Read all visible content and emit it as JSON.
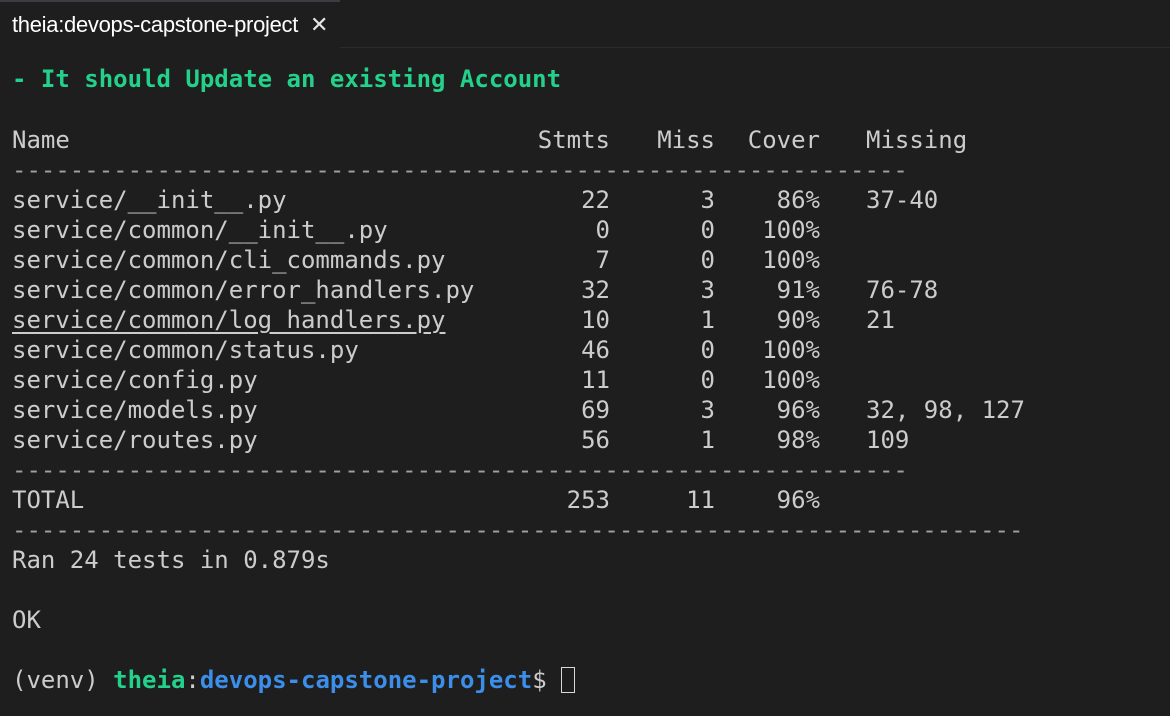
{
  "tab": {
    "title": "theia:devops-capstone-project",
    "close": "✕"
  },
  "test_line": "- It should Update an existing Account",
  "table": {
    "headers": {
      "name": "Name",
      "stmts": "Stmts",
      "miss": "Miss",
      "cover": "Cover",
      "missing": "Missing"
    },
    "rule": "--------------------------------------------------------------",
    "rows": [
      {
        "name": "service/__init__.py",
        "stmts": "22",
        "miss": "3",
        "cover": "86%",
        "missing": "37-40"
      },
      {
        "name": "service/common/__init__.py",
        "stmts": "0",
        "miss": "0",
        "cover": "100%",
        "missing": ""
      },
      {
        "name": "service/common/cli_commands.py",
        "stmts": "7",
        "miss": "0",
        "cover": "100%",
        "missing": ""
      },
      {
        "name": "service/common/error_handlers.py",
        "stmts": "32",
        "miss": "3",
        "cover": "91%",
        "missing": "76-78"
      },
      {
        "name": "service/common/log_handlers.py",
        "stmts": "10",
        "miss": "1",
        "cover": "90%",
        "missing": "21"
      },
      {
        "name": "service/common/status.py",
        "stmts": "46",
        "miss": "0",
        "cover": "100%",
        "missing": ""
      },
      {
        "name": "service/config.py",
        "stmts": "11",
        "miss": "0",
        "cover": "100%",
        "missing": ""
      },
      {
        "name": "service/models.py",
        "stmts": "69",
        "miss": "3",
        "cover": "96%",
        "missing": "32, 98, 127"
      },
      {
        "name": "service/routes.py",
        "stmts": "56",
        "miss": "1",
        "cover": "98%",
        "missing": "109"
      }
    ],
    "total": {
      "name": "TOTAL",
      "stmts": "253",
      "miss": "11",
      "cover": "96%"
    }
  },
  "long_rule": "----------------------------------------------------------------------",
  "ran_line": "Ran 24 tests in 0.879s",
  "ok_line": "OK",
  "prompt": {
    "venv": "(venv) ",
    "user": "theia",
    "colon": ":",
    "path": "devops-capstone-project",
    "dollar": "$"
  }
}
